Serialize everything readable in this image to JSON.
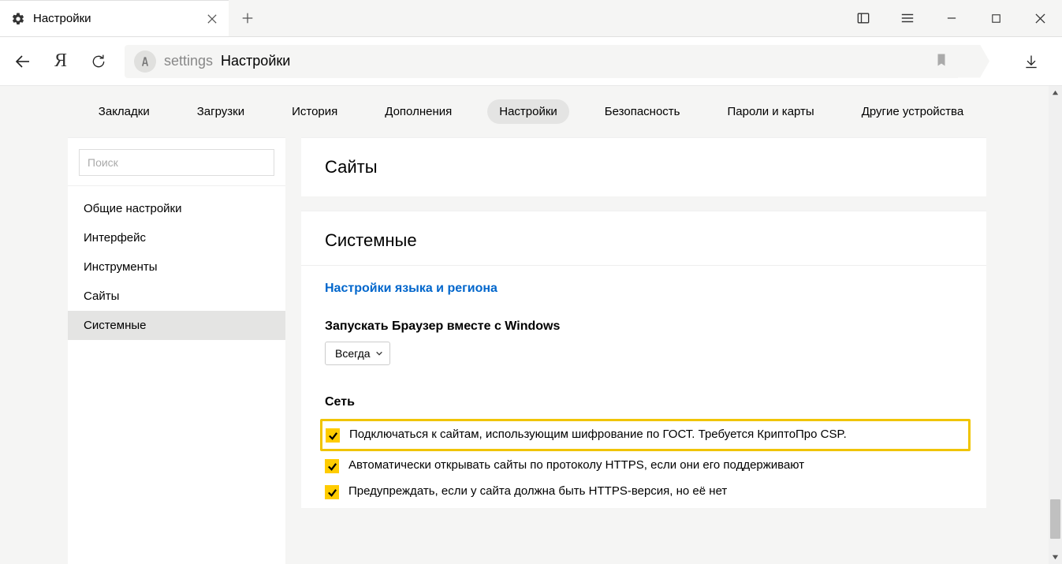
{
  "tab": {
    "title": "Настройки"
  },
  "address": {
    "proto": "settings",
    "page": "Настройки"
  },
  "topnav": {
    "items": [
      {
        "label": "Закладки"
      },
      {
        "label": "Загрузки"
      },
      {
        "label": "История"
      },
      {
        "label": "Дополнения"
      },
      {
        "label": "Настройки"
      },
      {
        "label": "Безопасность"
      },
      {
        "label": "Пароли и карты"
      },
      {
        "label": "Другие устройства"
      }
    ],
    "active_index": 4
  },
  "sidebar": {
    "search_placeholder": "Поиск",
    "items": [
      {
        "label": "Общие настройки"
      },
      {
        "label": "Интерфейс"
      },
      {
        "label": "Инструменты"
      },
      {
        "label": "Сайты"
      },
      {
        "label": "Системные"
      }
    ],
    "active_index": 4
  },
  "panels": {
    "sites": {
      "heading": "Сайты"
    },
    "system": {
      "heading": "Системные",
      "lang_link": "Настройки языка и региона",
      "launch_label": "Запускать Браузер вместе с Windows",
      "launch_value": "Всегда",
      "network_heading": "Сеть",
      "checks": [
        {
          "label": "Подключаться к сайтам, использующим шифрование по ГОСТ. Требуется КриптоПро CSP.",
          "checked": true,
          "highlight": true
        },
        {
          "label": "Автоматически открывать сайты по протоколу HTTPS, если они его поддерживают",
          "checked": true,
          "highlight": false
        },
        {
          "label": "Предупреждать, если у сайта должна быть HTTPS-версия, но её нет",
          "checked": true,
          "highlight": false
        }
      ]
    }
  }
}
